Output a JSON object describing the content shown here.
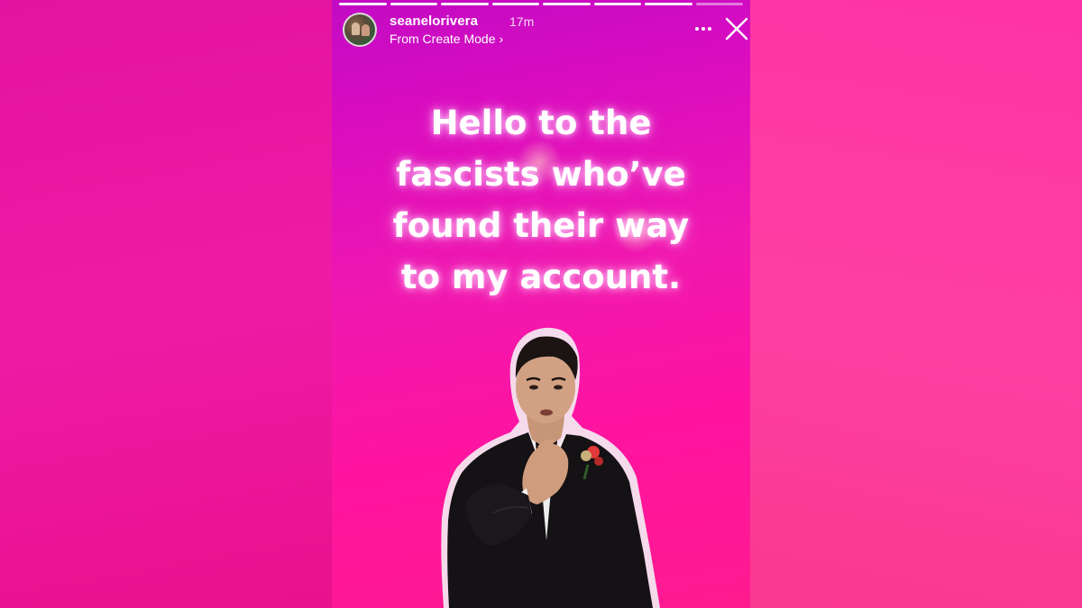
{
  "story": {
    "username": "seanelorivera",
    "timestamp": "17m",
    "subtitle": "From Create Mode",
    "subtitle_chevron": "›",
    "caption_lines": [
      "Hello to the",
      "fascists who’ve",
      "found their way",
      "to my account."
    ],
    "progress": {
      "segments_total": 8,
      "segments_viewed": 7
    },
    "icons": {
      "avatar": "profile-avatar",
      "more": "more-horizontal-icon",
      "close": "close-icon",
      "chevron": "chevron-right-icon"
    },
    "colors": {
      "background_top": "#c20bc4",
      "background_bottom": "#ff1a8f",
      "text": "#ffffff"
    }
  }
}
